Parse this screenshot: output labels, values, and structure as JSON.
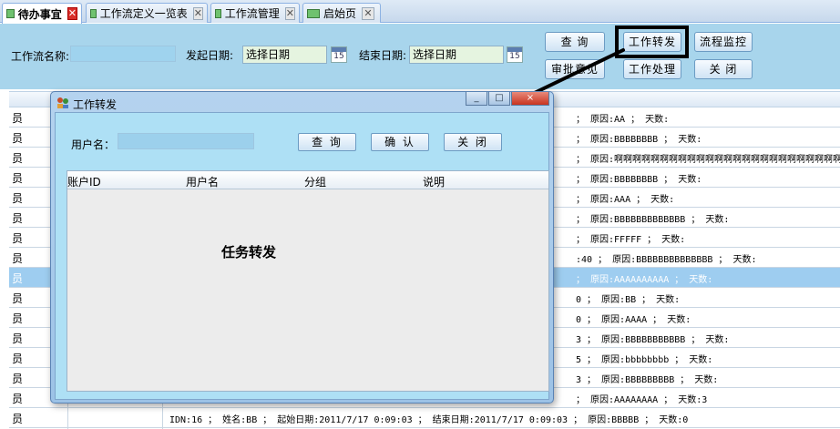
{
  "tabs": [
    {
      "label": "待办事宜",
      "active": true
    },
    {
      "label": "工作流定义一览表",
      "active": false
    },
    {
      "label": "工作流管理",
      "active": false
    },
    {
      "label": "启始页",
      "active": false
    }
  ],
  "filter": {
    "name_label": "工作流名称:",
    "start_label": "发起日期:",
    "start_placeholder": "选择日期",
    "end_label": "结束日期:",
    "end_placeholder": "选择日期",
    "calendar_day": "15"
  },
  "toolbar": {
    "query": "查 询",
    "forward": "工作转发",
    "monitor": "流程监控",
    "opinion": "审批意见",
    "process": "工作处理",
    "close": "关 闭"
  },
  "grid": {
    "rows": [
      {
        "col_a": "员",
        "col_b": "； 原因:AA ； 天数:"
      },
      {
        "col_a": "员",
        "col_b": "； 原因:BBBBBBBB ； 天数:"
      },
      {
        "col_a": "员",
        "col_b": "； 原因:啊啊啊啊啊啊啊啊啊啊啊啊啊啊啊啊啊啊啊啊啊啊啊啊啊"
      },
      {
        "col_a": "员",
        "col_b": "； 原因:BBBBBBBB ； 天数:"
      },
      {
        "col_a": "员",
        "col_b": "； 原因:AAA ； 天数:"
      },
      {
        "col_a": "员",
        "col_b": "； 原因:BBBBBBBBBBBBB ； 天数:"
      },
      {
        "col_a": "员",
        "col_b": "； 原因:FFFFF ； 天数:"
      },
      {
        "col_a": "员",
        "col_b": ":40 ； 原因:BBBBBBBBBBBBBB ； 天数:"
      },
      {
        "col_a": "员",
        "col_b": "； 原因:AAAAAAAAAA ； 天数:",
        "selected": true
      },
      {
        "col_a": "员",
        "col_b": "0 ； 原因:BB ； 天数:"
      },
      {
        "col_a": "员",
        "col_b": "0 ； 原因:AAAA ； 天数:"
      },
      {
        "col_a": "员",
        "col_b": "3 ； 原因:BBBBBBBBBBB ； 天数:"
      },
      {
        "col_a": "员",
        "col_b": "5 ； 原因:bbbbbbbb ； 天数:"
      },
      {
        "col_a": "员",
        "col_b": "3 ； 原因:BBBBBBBBB ； 天数:"
      },
      {
        "col_a": "员",
        "col_b": "； 原因:AAAAAAAA ； 天数:3"
      },
      {
        "col_a": "员",
        "full": "IDN:16 ； 姓名:BB ； 起始日期:2011/7/17 0:09:03 ； 结束日期:2011/7/17 0:09:03 ； 原因:BBBBB ； 天数:0"
      }
    ]
  },
  "dialog": {
    "title": "工作转发",
    "min": "_",
    "max": "□",
    "close": "×",
    "username_label": "用户名：",
    "query": "查 询",
    "confirm": "确 认",
    "close_btn": "关 闭",
    "columns": [
      "账户ID",
      "用户名",
      "分组",
      "说明"
    ],
    "center_text": "任务转发"
  },
  "colors": {
    "accent": "#a8d5ec",
    "selected_row": "#9ecdf0",
    "highlight": "#000000"
  }
}
